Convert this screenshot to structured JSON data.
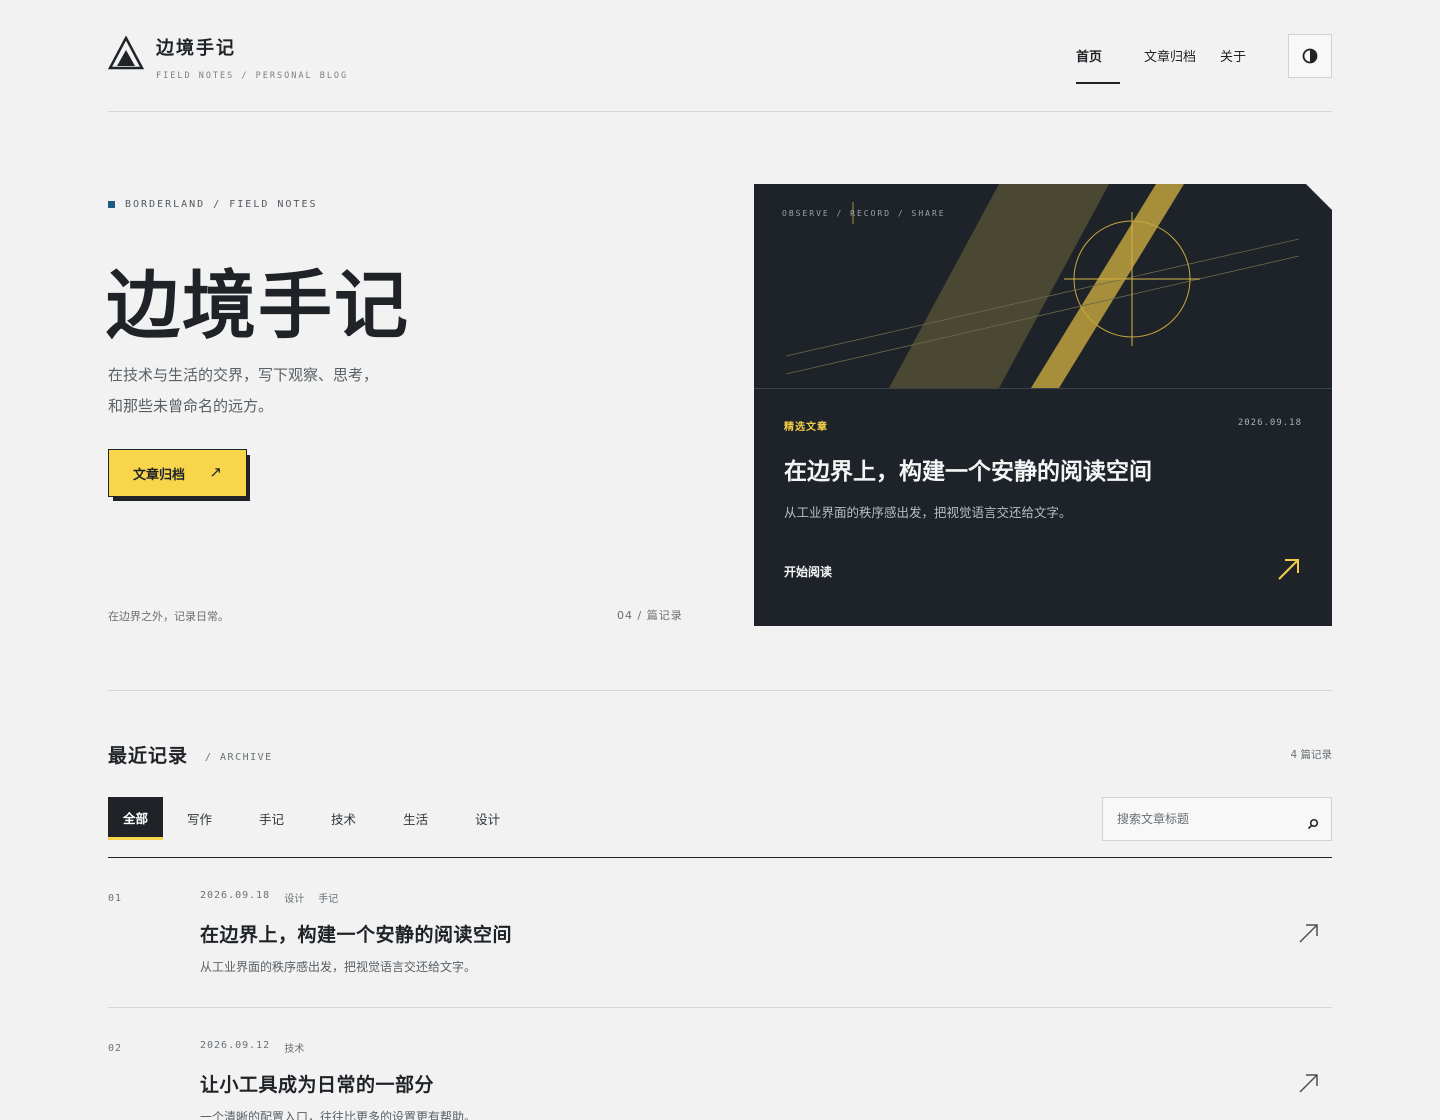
{
  "header": {
    "site_title": "边境手记",
    "site_subtitle": "FIELD NOTES / PERSONAL BLOG",
    "nav": {
      "home": "首页",
      "archive": "文章归档",
      "about": "关于"
    },
    "theme_toggle_icon": "contrast-icon"
  },
  "hero": {
    "kicker": "BORDERLAND / FIELD NOTES",
    "title": "边境手记",
    "desc_line1": "在技术与生活的交界，写下观察、思考，",
    "desc_line2": "和那些未曾命名的远方。",
    "cta_label": "文章归档",
    "cta_arrow": "↗",
    "note": "在边界之外，记录日常。",
    "count": "04 / 篇记录"
  },
  "featured": {
    "kicker": "OBSERVE / RECORD / SHARE",
    "tag": "精选文章",
    "date": "2026.09.18",
    "title": "在边界上，构建一个安静的阅读空间",
    "desc": "从工业界面的秩序感出发，把视觉语言交还给文字。",
    "read_label": "开始阅读",
    "accent": "#f2cd48"
  },
  "archive": {
    "title": "最近记录",
    "subtitle": "/ ARCHIVE",
    "count": "4 篇记录",
    "filters": [
      "全部",
      "写作",
      "手记",
      "技术",
      "生活",
      "设计"
    ],
    "active_filter": "全部",
    "search_placeholder": "搜索文章标题",
    "posts": [
      {
        "num": "01",
        "date": "2026.09.18",
        "tags": [
          "设计",
          "手记"
        ],
        "title": "在边界上，构建一个安静的阅读空间",
        "desc": "从工业界面的秩序感出发，把视觉语言交还给文字。"
      },
      {
        "num": "02",
        "date": "2026.09.12",
        "tags": [
          "技术"
        ],
        "title": "让小工具成为日常的一部分",
        "desc": "一个清晰的配置入口，往往比更多的设置更有帮助。"
      }
    ]
  },
  "colors": {
    "background": "#f1f2f1",
    "ink": "#1f2328",
    "accent_yellow": "#f8d54a",
    "accent_blue": "#1f5c84",
    "card_dark": "#1e232a"
  }
}
